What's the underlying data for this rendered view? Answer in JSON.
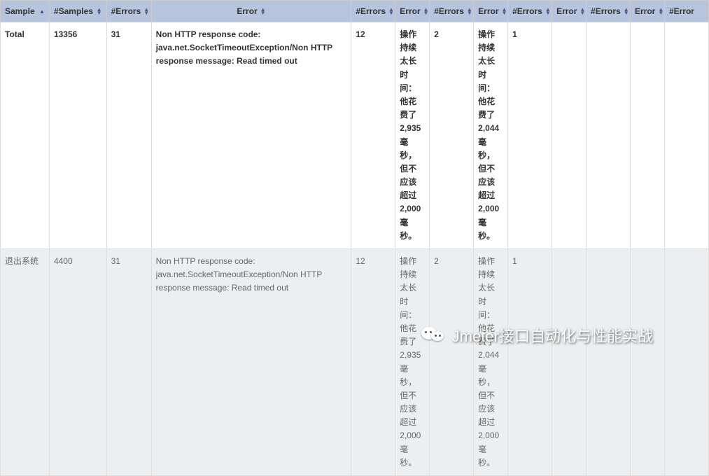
{
  "headers": {
    "sample": "Sample",
    "samples": "#Samples",
    "errors": "#Errors",
    "error": "Error",
    "errors2": "#Errors",
    "error2": "Error",
    "errors3": "#Errors",
    "error3": "Error",
    "errors4": "#Errors",
    "error4": "Error",
    "errors5": "#Errors",
    "error5": "Error",
    "errors6": "#Error"
  },
  "rows": [
    {
      "sample": "Total",
      "samples": "13356",
      "errors": "31",
      "error_main": "Non HTTP response code: java.net.SocketTimeoutException/Non HTTP response message: Read timed out",
      "errors2": "12",
      "error2": "操作持续太长时间：他花费了 2,935 毫秒，但不应该超过 2,000 毫秒。",
      "errors3": "2",
      "error3": "操作持续太长时间：他花费了 2,044 毫秒，但不应该超过 2,000 毫秒。",
      "errors4": "1",
      "error4": "",
      "errors5": "",
      "error5": "",
      "errors6": ""
    },
    {
      "sample": "退出系统",
      "samples": "4400",
      "errors": "31",
      "error_main": "Non HTTP response code: java.net.SocketTimeoutException/Non HTTP response message: Read timed out",
      "errors2": "12",
      "error2": "操作持续太长时间：他花费了 2,935 毫秒，但不应该超过 2,000 毫秒。",
      "errors3": "2",
      "error3": "操作持续太长时间：他花费了 2,044 毫秒，但不应该超过 2,000 毫秒。",
      "errors4": "1",
      "error4": "",
      "errors5": "",
      "error5": "",
      "errors6": ""
    }
  ],
  "watermark": {
    "text": "Jmeter接口自动化与性能实战"
  }
}
